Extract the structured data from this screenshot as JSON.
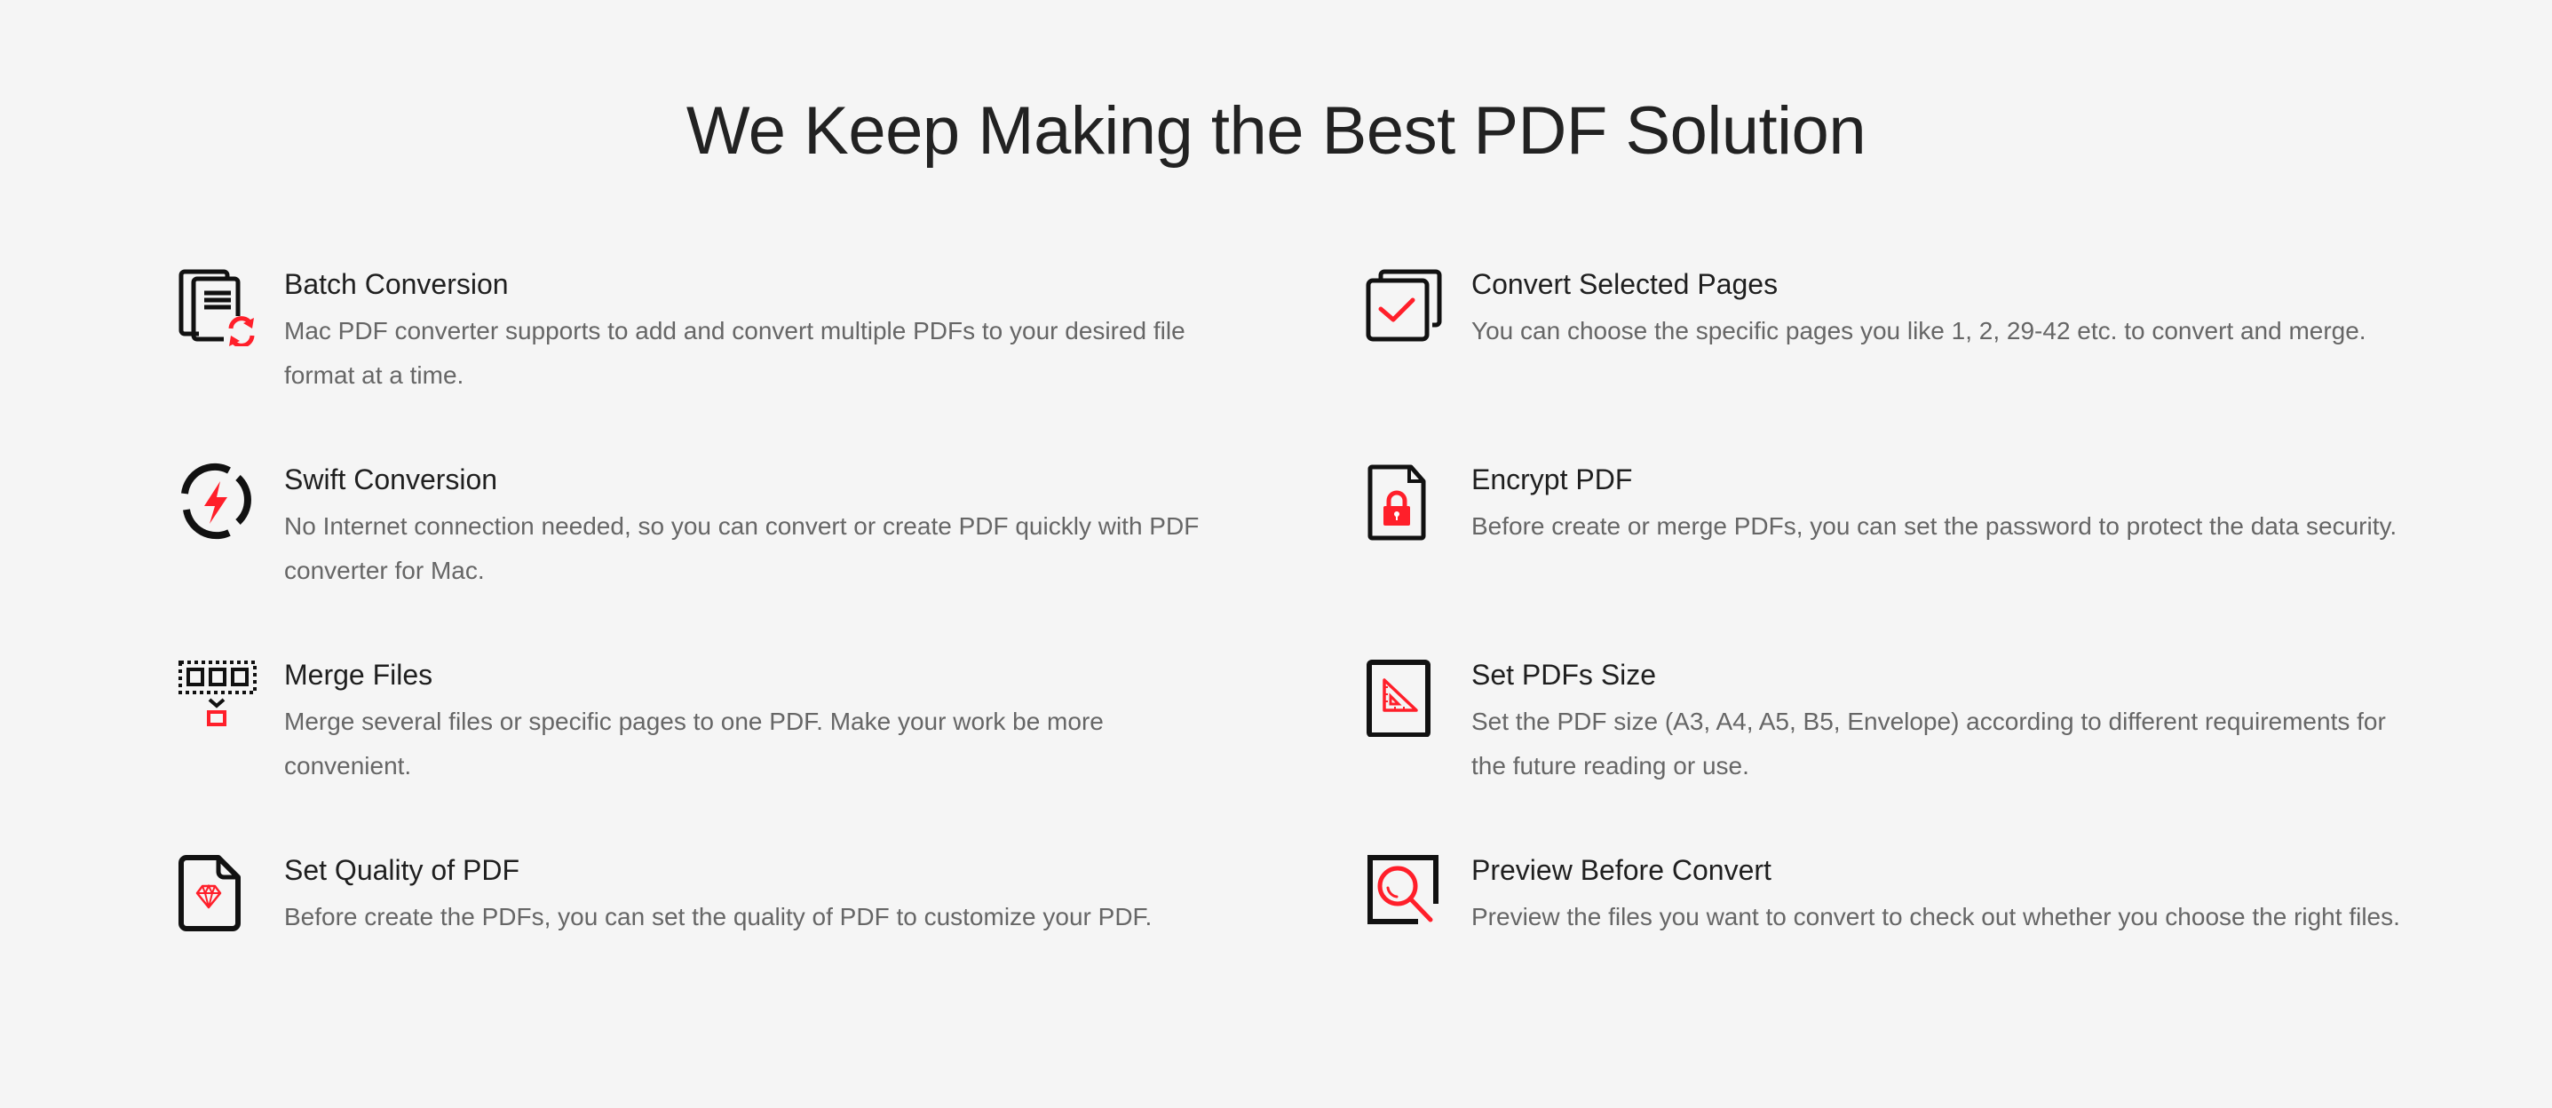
{
  "page": {
    "title": "We Keep Making the Best PDF Solution"
  },
  "colors": {
    "background": "#f5f5f5",
    "accent": "#ff1f2a",
    "icon_stroke": "#111111",
    "heading": "#1f1f1f",
    "body": "#666666"
  },
  "features": [
    {
      "icon": "batch-conversion-icon",
      "title": "Batch Conversion",
      "description": "Mac PDF converter supports to add and convert multiple PDFs to your desired file format at a time."
    },
    {
      "icon": "convert-selected-pages-icon",
      "title": "Convert Selected Pages",
      "description": "You can choose the specific pages you like 1, 2, 29-42 etc. to convert and merge."
    },
    {
      "icon": "swift-conversion-icon",
      "title": "Swift Conversion",
      "description": "No Internet connection needed, so you can convert or create PDF quickly with PDF converter for Mac."
    },
    {
      "icon": "encrypt-pdf-icon",
      "title": "Encrypt PDF",
      "description": "Before create or merge PDFs, you can set the password to protect the data security."
    },
    {
      "icon": "merge-files-icon",
      "title": "Merge Files",
      "description": "Merge several files or specific pages to one PDF. Make your work be more convenient."
    },
    {
      "icon": "set-pdf-size-icon",
      "title": "Set PDFs Size",
      "description": "Set the PDF size (A3, A4, A5, B5, Envelope) according to different requirements for the future reading or use."
    },
    {
      "icon": "set-quality-icon",
      "title": "Set Quality of PDF",
      "description": "Before create the PDFs, you can set the quality of PDF to customize your PDF."
    },
    {
      "icon": "preview-before-convert-icon",
      "title": "Preview Before Convert",
      "description": "Preview the files you want to convert to check out whether you choose the right files."
    }
  ]
}
